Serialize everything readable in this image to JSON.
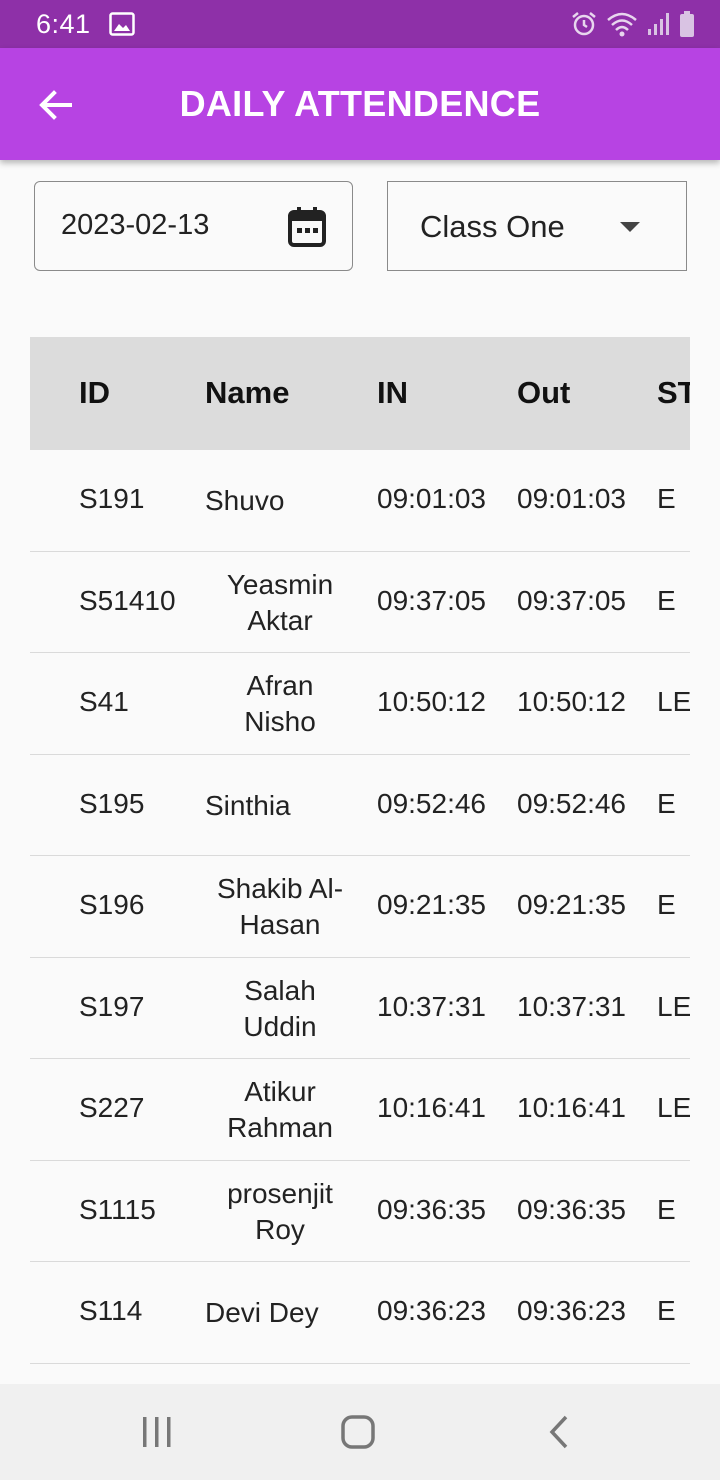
{
  "status_bar": {
    "time": "6:41",
    "icons": [
      "image-icon",
      "alarm-icon",
      "wifi-icon",
      "signal-icon",
      "battery-icon"
    ]
  },
  "app_bar": {
    "title": "DAILY ATTENDENCE",
    "back_icon": "arrow-back-icon",
    "color": "#b743e3"
  },
  "filters": {
    "date": "2023-02-13",
    "date_icon": "calendar-icon",
    "class_selected": "Class One",
    "class_icon": "dropdown-arrow-icon"
  },
  "table": {
    "columns": [
      "ID",
      "Name",
      "IN",
      "Out",
      "ST"
    ],
    "rows": [
      {
        "id": "S191",
        "name": [
          "Shuvo"
        ],
        "in": "09:01:03",
        "out": "09:01:03",
        "st": "E"
      },
      {
        "id": "S51410",
        "name": [
          "Yeasmin",
          "Aktar"
        ],
        "in": "09:37:05",
        "out": "09:37:05",
        "st": "E"
      },
      {
        "id": "S41",
        "name": [
          "Afran",
          "Nisho"
        ],
        "in": "10:50:12",
        "out": "10:50:12",
        "st": "LE"
      },
      {
        "id": "S195",
        "name": [
          "Sinthia"
        ],
        "in": "09:52:46",
        "out": "09:52:46",
        "st": "E"
      },
      {
        "id": "S196",
        "name": [
          "Shakib Al-",
          "Hasan"
        ],
        "in": "09:21:35",
        "out": "09:21:35",
        "st": "E"
      },
      {
        "id": "S197",
        "name": [
          "Salah",
          "Uddin"
        ],
        "in": "10:37:31",
        "out": "10:37:31",
        "st": "LE"
      },
      {
        "id": "S227",
        "name": [
          "Atikur",
          "Rahman"
        ],
        "in": "10:16:41",
        "out": "10:16:41",
        "st": "LE"
      },
      {
        "id": "S1115",
        "name": [
          "prosenjit",
          "Roy"
        ],
        "in": "09:36:35",
        "out": "09:36:35",
        "st": "E"
      },
      {
        "id": "S114",
        "name": [
          "Devi Dey"
        ],
        "in": "09:36:23",
        "out": "09:36:23",
        "st": "E"
      }
    ]
  },
  "nav_bar": {
    "buttons": [
      "recent-apps-icon",
      "home-icon",
      "back-nav-icon"
    ]
  }
}
